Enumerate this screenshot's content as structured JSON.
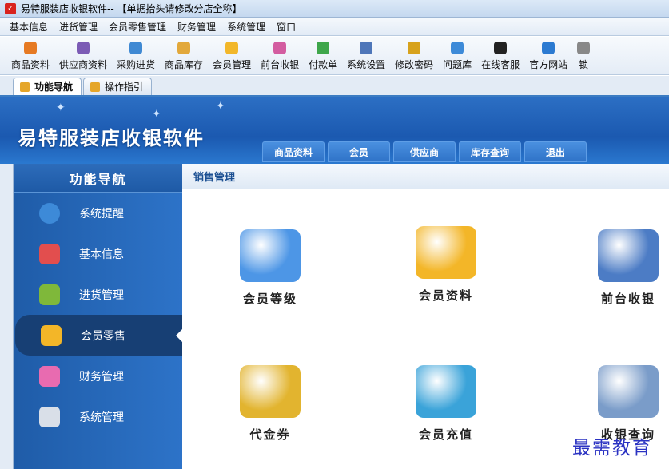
{
  "window": {
    "title": "易特服装店收银软件-- 【单据抬头请修改分店全称】"
  },
  "menu": [
    "基本信息",
    "进货管理",
    "会员零售管理",
    "财务管理",
    "系统管理",
    "窗口"
  ],
  "toolbar": [
    {
      "label": "商品资料",
      "icon": "goods-icon",
      "color": "#e67a23"
    },
    {
      "label": "供应商资料",
      "icon": "supplier-icon",
      "color": "#7b5bb5"
    },
    {
      "label": "采购进货",
      "icon": "truck-icon",
      "color": "#3f89d3"
    },
    {
      "label": "商品库存",
      "icon": "inventory-icon",
      "color": "#e2a83b"
    },
    {
      "label": "会员管理",
      "icon": "member-icon",
      "color": "#f2b72a"
    },
    {
      "label": "前台收银",
      "icon": "cashier-icon",
      "color": "#d35ca0"
    },
    {
      "label": "付款单",
      "icon": "payment-icon",
      "color": "#3ea64b"
    },
    {
      "label": "系统设置",
      "icon": "settings-icon",
      "color": "#4e76b9"
    },
    {
      "label": "修改密码",
      "icon": "key-icon",
      "color": "#d7a21c"
    },
    {
      "label": "问题库",
      "icon": "question-icon",
      "color": "#3d8ad8"
    },
    {
      "label": "在线客服",
      "icon": "qq-icon",
      "color": "#222222"
    },
    {
      "label": "官方网站",
      "icon": "ie-icon",
      "color": "#2b7ad1"
    },
    {
      "label": "锁",
      "icon": "lock-icon",
      "color": "#888888"
    }
  ],
  "tabs": [
    {
      "label": "功能导航",
      "active": true
    },
    {
      "label": "操作指引",
      "active": false
    }
  ],
  "banner": {
    "brand": "易特服装店收银软件",
    "navtabs": [
      "商品资料",
      "会员",
      "供应商",
      "库存查询",
      "退出"
    ]
  },
  "sidebar": {
    "header": "功能导航",
    "items": [
      {
        "label": "系统提醒",
        "icon": "info-icon",
        "color": "#3d8ad8",
        "active": false
      },
      {
        "label": "基本信息",
        "icon": "cubes-icon",
        "color": "#e24e4e",
        "active": false
      },
      {
        "label": "进货管理",
        "icon": "box-icon",
        "color": "#7fb83a",
        "active": false
      },
      {
        "label": "会员零售",
        "icon": "chat-user-icon",
        "color": "#f3b628",
        "active": true
      },
      {
        "label": "财务管理",
        "icon": "finance-icon",
        "color": "#e86bb0",
        "active": false
      },
      {
        "label": "系统管理",
        "icon": "tools-icon",
        "color": "#d9dfe8",
        "active": false
      }
    ]
  },
  "content": {
    "header": "销售管理",
    "items": [
      {
        "label": "会员等级",
        "icon": "member-level-icon",
        "color": "#4d96e6"
      },
      {
        "label": "会员资料",
        "icon": "member-profile-icon",
        "color": "#f3b628"
      },
      {
        "label": "前台收银",
        "icon": "pos-computer-icon",
        "color": "#4c7cc5"
      },
      {
        "label": "代金券",
        "icon": "voucher-icon",
        "color": "#e2b42f"
      },
      {
        "label": "会员充值",
        "icon": "recharge-card-icon",
        "color": "#3aa3d9"
      },
      {
        "label": "收银查询",
        "icon": "search-chart-icon",
        "color": "#7a9cc9"
      }
    ]
  },
  "watermark": "最需教育"
}
